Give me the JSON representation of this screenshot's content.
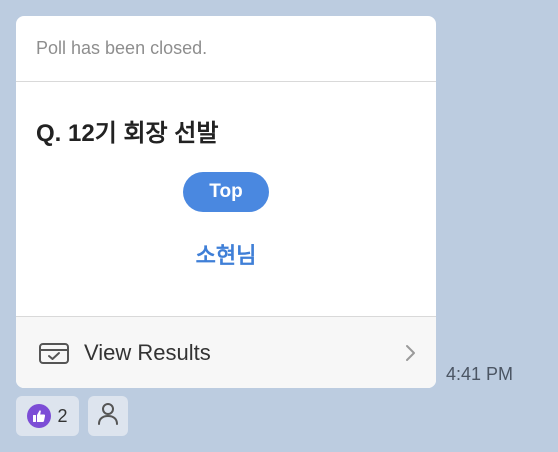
{
  "poll": {
    "status_text": "Poll has been closed.",
    "question": "Q. 12기 회장 선발",
    "badge_label": "Top",
    "winner": "소현님",
    "view_results_label": "View Results",
    "icons": {
      "results": "inbox-check-icon",
      "chevron": "chevron-right-icon"
    }
  },
  "message": {
    "timestamp": "4:41 PM"
  },
  "reactions": {
    "like_count": "2",
    "like_icon": "thumbs-up-icon",
    "member_icon": "person-icon"
  },
  "colors": {
    "background": "#bccce0",
    "accent": "#4a88e0",
    "like": "#7c4dd6"
  }
}
